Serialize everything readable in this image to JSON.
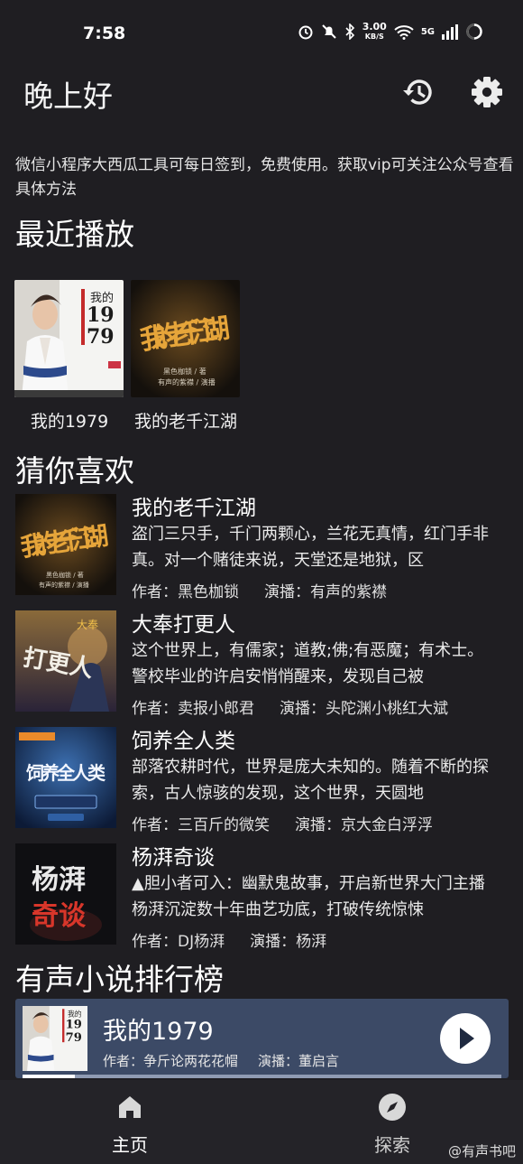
{
  "status_bar": {
    "time": "7:58",
    "speed_value": "3.00",
    "speed_unit": "KB/S",
    "network": "5G"
  },
  "header": {
    "greeting": "晚上好"
  },
  "notice": "微信小程序大西瓜工具可每日签到，免费使用。获取vip可关注公众号查看具体方法",
  "sections": {
    "recent": "最近播放",
    "recommend": "猜你喜欢",
    "ranking": "有声小说排行榜"
  },
  "recent": [
    {
      "name": "我的1979"
    },
    {
      "name": "我的老千江湖"
    }
  ],
  "recommend": [
    {
      "title": "我的老千江湖",
      "desc": "盗门三只手，千门两颗心，兰花无真情，红门手非真。对一个赌徒来说，天堂还是地狱，区",
      "author": "作者：黑色枷锁",
      "narrator": "演播：有声的紫襟"
    },
    {
      "title": "大奉打更人",
      "desc": "这个世界上，有儒家；道教;佛;有恶魔；有术士。警校毕业的许启安悄悄醒来，发现自己被",
      "author": "作者：卖报小郎君",
      "narrator": "演播：头陀渊小桃红大斌"
    },
    {
      "title": "饲养全人类",
      "desc": "部落农耕时代，世界是庞大未知的。随着不断的探索，古人惊骇的发现，这个世界，天圆地",
      "author": "作者：三百斤的微笑",
      "narrator": "演播：京大金白浮浮"
    },
    {
      "title": "杨湃奇谈",
      "desc": "▲胆小者可入：幽默鬼故事，开启新世界大门主播杨湃沉淀数十年曲艺功底，打破传统惊悚",
      "author": "作者：DJ杨湃",
      "narrator": "演播：杨湃"
    }
  ],
  "player": {
    "title": "我的1979",
    "author": "作者：争斤论两花花帽",
    "narrator": "演播：董启言",
    "progress": 0.11
  },
  "tabs": [
    {
      "label": "主页"
    },
    {
      "label": "探索"
    }
  ],
  "covers": {
    "my1979_title": "我的",
    "my1979_num1": "19",
    "my1979_num2": "79",
    "laoqian_art": "我的老千江湖",
    "laoqian_author": "黑色枷锁 / 著",
    "laoqian_narr": "有声的紫襟 / 演播",
    "dafeng_big": "打更人",
    "dafeng_small": "大奉",
    "siyang_art": "饲养全人类",
    "yangpai_a": "杨湃",
    "yangpai_b": "奇谈"
  },
  "watermark": "@有声书吧",
  "colors": {
    "background": "#1f1e22",
    "player_bg": "#3c4a66",
    "tabbar_bg": "#242328"
  }
}
